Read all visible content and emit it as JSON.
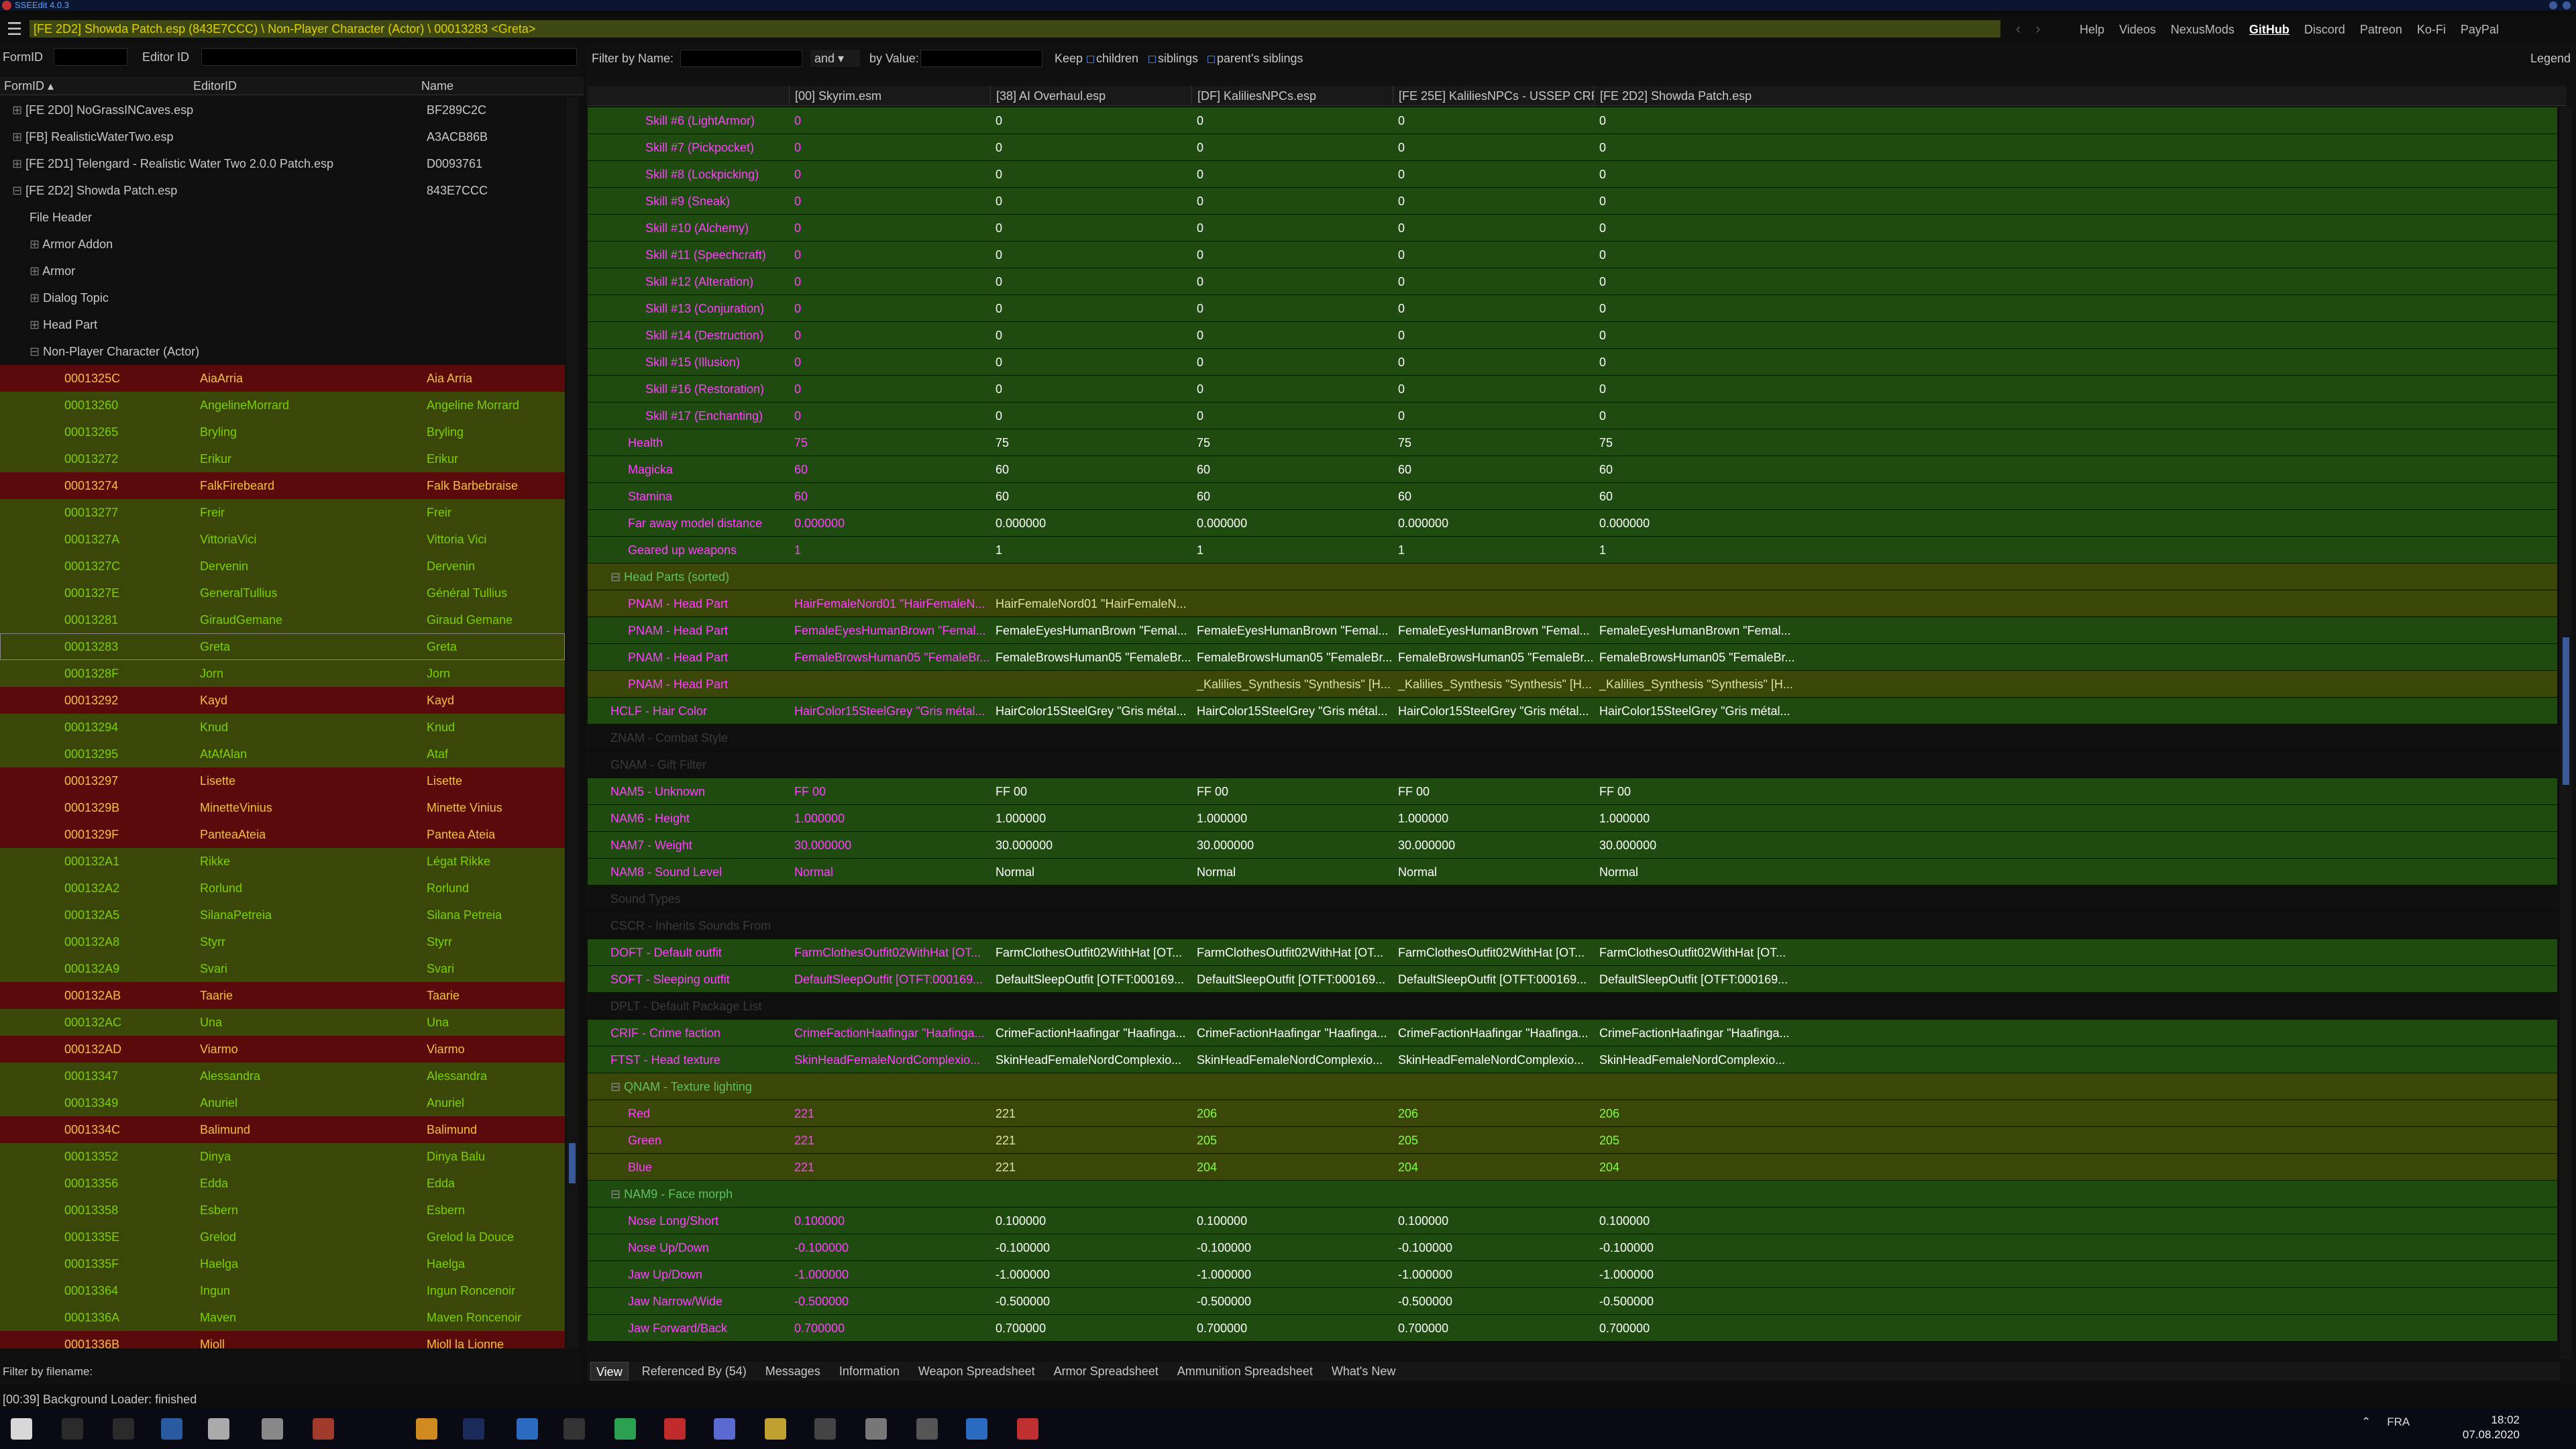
{
  "window": {
    "title": "SSEEdit 4.0.3"
  },
  "header": {
    "path": "[FE 2D2] Showda Patch.esp (843E7CCC) \\ Non-Player Character (Actor) \\ 00013283 <Greta>"
  },
  "toplinks": [
    "Help",
    "Videos",
    "NexusMods",
    "GitHub",
    "Discord",
    "Patreon",
    "Ko-Fi",
    "PayPal"
  ],
  "left": {
    "formid_label": "FormID",
    "editorid_label": "Editor ID",
    "columns": [
      "FormID",
      "EditorID",
      "Name"
    ],
    "plugins": [
      {
        "label": "[FE 2D0] NoGrassINCaves.esp",
        "id": "BF289C2C"
      },
      {
        "label": "[FB] RealisticWaterTwo.esp",
        "id": "A3ACB86B"
      },
      {
        "label": "[FE 2D1] Telengard - Realistic Water Two 2.0.0 Patch.esp",
        "id": "D0093761"
      },
      {
        "label": "[FE 2D2] Showda Patch.esp",
        "id": "843E7CCC"
      }
    ],
    "groups": [
      "File Header",
      "Armor Addon",
      "Armor",
      "Dialog Topic",
      "Head Part",
      "Non-Player Character (Actor)"
    ],
    "npcs": [
      {
        "f": "0001325C",
        "e": "AiaArria",
        "n": "Aia Arria",
        "c": "red"
      },
      {
        "f": "00013260",
        "e": "AngelineMorrard",
        "n": "Angeline Morrard",
        "c": "grn"
      },
      {
        "f": "00013265",
        "e": "Bryling",
        "n": "Bryling",
        "c": "grn"
      },
      {
        "f": "00013272",
        "e": "Erikur",
        "n": "Erikur",
        "c": "grn"
      },
      {
        "f": "00013274",
        "e": "FalkFirebeard",
        "n": "Falk Barbebraise",
        "c": "red"
      },
      {
        "f": "00013277",
        "e": "Freir",
        "n": "Freir",
        "c": "grn"
      },
      {
        "f": "0001327A",
        "e": "VittoriaVici",
        "n": "Vittoria Vici",
        "c": "grn"
      },
      {
        "f": "0001327C",
        "e": "Dervenin",
        "n": "Dervenin",
        "c": "grn"
      },
      {
        "f": "0001327E",
        "e": "GeneralTullius",
        "n": "Général Tullius",
        "c": "grn"
      },
      {
        "f": "00013281",
        "e": "GiraudGemane",
        "n": "Giraud Gemane",
        "c": "grn"
      },
      {
        "f": "00013283",
        "e": "Greta",
        "n": "Greta",
        "c": "sel"
      },
      {
        "f": "0001328F",
        "e": "Jorn",
        "n": "Jorn",
        "c": "grn"
      },
      {
        "f": "00013292",
        "e": "Kayd",
        "n": "Kayd",
        "c": "red"
      },
      {
        "f": "00013294",
        "e": "Knud",
        "n": "Knud",
        "c": "grn"
      },
      {
        "f": "00013295",
        "e": "AtAfAlan",
        "n": "Ataf",
        "c": "grn"
      },
      {
        "f": "00013297",
        "e": "Lisette",
        "n": "Lisette",
        "c": "red"
      },
      {
        "f": "0001329B",
        "e": "MinetteVinius",
        "n": "Minette Vinius",
        "c": "red"
      },
      {
        "f": "0001329F",
        "e": "PanteaAteia",
        "n": "Pantea Ateia",
        "c": "red"
      },
      {
        "f": "000132A1",
        "e": "Rikke",
        "n": "Légat Rikke",
        "c": "grn"
      },
      {
        "f": "000132A2",
        "e": "Rorlund",
        "n": "Rorlund",
        "c": "grn"
      },
      {
        "f": "000132A5",
        "e": "SilanaPetreia",
        "n": "Silana Petreia",
        "c": "grn"
      },
      {
        "f": "000132A8",
        "e": "Styrr",
        "n": "Styrr",
        "c": "grn"
      },
      {
        "f": "000132A9",
        "e": "Svari",
        "n": "Svari",
        "c": "grn"
      },
      {
        "f": "000132AB",
        "e": "Taarie",
        "n": "Taarie",
        "c": "red"
      },
      {
        "f": "000132AC",
        "e": "Una",
        "n": "Una",
        "c": "grn"
      },
      {
        "f": "000132AD",
        "e": "Viarmo",
        "n": "Viarmo",
        "c": "red"
      },
      {
        "f": "00013347",
        "e": "Alessandra",
        "n": "Alessandra",
        "c": "grn"
      },
      {
        "f": "00013349",
        "e": "Anuriel",
        "n": "Anuriel",
        "c": "grn"
      },
      {
        "f": "0001334C",
        "e": "Balimund",
        "n": "Balimund",
        "c": "red"
      },
      {
        "f": "00013352",
        "e": "Dinya",
        "n": "Dinya Balu",
        "c": "grn"
      },
      {
        "f": "00013356",
        "e": "Edda",
        "n": "Edda",
        "c": "grn"
      },
      {
        "f": "00013358",
        "e": "Esbern",
        "n": "Esbern",
        "c": "grn"
      },
      {
        "f": "0001335E",
        "e": "Grelod",
        "n": "Grelod la Douce",
        "c": "grn"
      },
      {
        "f": "0001335F",
        "e": "Haelga",
        "n": "Haelga",
        "c": "grn"
      },
      {
        "f": "00013364",
        "e": "Ingun",
        "n": "Ingun Roncenoir",
        "c": "grn"
      },
      {
        "f": "0001336A",
        "e": "Maven",
        "n": "Maven Roncenoir",
        "c": "grn"
      },
      {
        "f": "0001336B",
        "e": "Mjoll",
        "n": "Mjoll la Lionne",
        "c": "red"
      }
    ],
    "filter_label": "Filter by filename:"
  },
  "right": {
    "filter_name_label": "Filter by Name:",
    "and_label": "and",
    "filter_value_label": "by Value:",
    "keep_label": "Keep",
    "keep_options": [
      "children",
      "siblings",
      "parent's siblings"
    ],
    "legend_label": "Legend",
    "columns": [
      "[00] Skyrim.esm",
      "[38] AI Overhaul.esp",
      "[DF] KaliliesNPCs.esp",
      "[FE 25E] KaliliesNPCs - USSEP CRF ...",
      "[FE 2D2] Showda Patch.esp"
    ],
    "rows": [
      {
        "l": "Skill #6 (LightArmor)",
        "v": [
          "0",
          "0",
          "0",
          "0",
          "0"
        ],
        "c": "g",
        "i": 3
      },
      {
        "l": "Skill #7 (Pickpocket)",
        "v": [
          "0",
          "0",
          "0",
          "0",
          "0"
        ],
        "c": "g",
        "i": 3
      },
      {
        "l": "Skill #8 (Lockpicking)",
        "v": [
          "0",
          "0",
          "0",
          "0",
          "0"
        ],
        "c": "g",
        "i": 3
      },
      {
        "l": "Skill #9 (Sneak)",
        "v": [
          "0",
          "0",
          "0",
          "0",
          "0"
        ],
        "c": "g",
        "i": 3
      },
      {
        "l": "Skill #10 (Alchemy)",
        "v": [
          "0",
          "0",
          "0",
          "0",
          "0"
        ],
        "c": "g",
        "i": 3
      },
      {
        "l": "Skill #11 (Speechcraft)",
        "v": [
          "0",
          "0",
          "0",
          "0",
          "0"
        ],
        "c": "g",
        "i": 3
      },
      {
        "l": "Skill #12 (Alteration)",
        "v": [
          "0",
          "0",
          "0",
          "0",
          "0"
        ],
        "c": "g",
        "i": 3
      },
      {
        "l": "Skill #13 (Conjuration)",
        "v": [
          "0",
          "0",
          "0",
          "0",
          "0"
        ],
        "c": "g",
        "i": 3
      },
      {
        "l": "Skill #14 (Destruction)",
        "v": [
          "0",
          "0",
          "0",
          "0",
          "0"
        ],
        "c": "g",
        "i": 3
      },
      {
        "l": "Skill #15 (Illusion)",
        "v": [
          "0",
          "0",
          "0",
          "0",
          "0"
        ],
        "c": "g",
        "i": 3
      },
      {
        "l": "Skill #16 (Restoration)",
        "v": [
          "0",
          "0",
          "0",
          "0",
          "0"
        ],
        "c": "g",
        "i": 3
      },
      {
        "l": "Skill #17 (Enchanting)",
        "v": [
          "0",
          "0",
          "0",
          "0",
          "0"
        ],
        "c": "g",
        "i": 3
      },
      {
        "l": "Health",
        "v": [
          "75",
          "75",
          "75",
          "75",
          "75"
        ],
        "c": "g",
        "i": 2
      },
      {
        "l": "Magicka",
        "v": [
          "60",
          "60",
          "60",
          "60",
          "60"
        ],
        "c": "g",
        "i": 2
      },
      {
        "l": "Stamina",
        "v": [
          "60",
          "60",
          "60",
          "60",
          "60"
        ],
        "c": "g",
        "i": 2
      },
      {
        "l": "Far away model distance",
        "v": [
          "0.000000",
          "0.000000",
          "0.000000",
          "0.000000",
          "0.000000"
        ],
        "c": "g",
        "i": 2
      },
      {
        "l": "Geared up weapons",
        "v": [
          "1",
          "1",
          "1",
          "1",
          "1"
        ],
        "c": "g",
        "i": 2
      },
      {
        "l": "Head Parts (sorted)",
        "v": [
          "",
          "",
          "",
          "",
          ""
        ],
        "c": "y",
        "i": 1,
        "exp": true
      },
      {
        "l": "PNAM - Head Part",
        "v": [
          "HairFemaleNord01 \"HairFemaleN...",
          "HairFemaleNord01 \"HairFemaleN...",
          "",
          "",
          ""
        ],
        "c": "y",
        "i": 2
      },
      {
        "l": "PNAM - Head Part",
        "v": [
          "FemaleEyesHumanBrown \"Femal...",
          "FemaleEyesHumanBrown \"Femal...",
          "FemaleEyesHumanBrown \"Femal...",
          "FemaleEyesHumanBrown \"Femal...",
          "FemaleEyesHumanBrown \"Femal..."
        ],
        "c": "g",
        "i": 2
      },
      {
        "l": "PNAM - Head Part",
        "v": [
          "FemaleBrowsHuman05 \"FemaleBr...",
          "FemaleBrowsHuman05 \"FemaleBr...",
          "FemaleBrowsHuman05 \"FemaleBr...",
          "FemaleBrowsHuman05 \"FemaleBr...",
          "FemaleBrowsHuman05 \"FemaleBr..."
        ],
        "c": "g",
        "i": 2
      },
      {
        "l": "PNAM - Head Part",
        "v": [
          "",
          "",
          "_Kalilies_Synthesis \"Synthesis\" [H...",
          "_Kalilies_Synthesis \"Synthesis\" [H...",
          "_Kalilies_Synthesis \"Synthesis\" [H..."
        ],
        "c": "y",
        "i": 2
      },
      {
        "l": "HCLF - Hair Color",
        "v": [
          "HairColor15SteelGrey \"Gris métal...",
          "HairColor15SteelGrey \"Gris métal...",
          "HairColor15SteelGrey \"Gris métal...",
          "HairColor15SteelGrey \"Gris métal...",
          "HairColor15SteelGrey \"Gris métal..."
        ],
        "c": "g",
        "i": 1
      },
      {
        "l": "ZNAM - Combat Style",
        "v": [
          "",
          "",
          "",
          "",
          ""
        ],
        "c": "x",
        "i": 1
      },
      {
        "l": "GNAM - Gift Filter",
        "v": [
          "",
          "",
          "",
          "",
          ""
        ],
        "c": "x",
        "i": 1
      },
      {
        "l": "NAM5 - Unknown",
        "v": [
          "FF 00",
          "FF 00",
          "FF 00",
          "FF 00",
          "FF 00"
        ],
        "c": "g",
        "i": 1
      },
      {
        "l": "NAM6 - Height",
        "v": [
          "1.000000",
          "1.000000",
          "1.000000",
          "1.000000",
          "1.000000"
        ],
        "c": "g",
        "i": 1
      },
      {
        "l": "NAM7 - Weight",
        "v": [
          "30.000000",
          "30.000000",
          "30.000000",
          "30.000000",
          "30.000000"
        ],
        "c": "g",
        "i": 1
      },
      {
        "l": "NAM8 - Sound Level",
        "v": [
          "Normal",
          "Normal",
          "Normal",
          "Normal",
          "Normal"
        ],
        "c": "g",
        "i": 1
      },
      {
        "l": "Sound Types",
        "v": [
          "",
          "",
          "",
          "",
          ""
        ],
        "c": "x",
        "i": 1
      },
      {
        "l": "CSCR - Inherits Sounds From",
        "v": [
          "",
          "",
          "",
          "",
          ""
        ],
        "c": "x",
        "i": 1
      },
      {
        "l": "DOFT - Default outfit",
        "v": [
          "FarmClothesOutfit02WithHat [OT...",
          "FarmClothesOutfit02WithHat [OT...",
          "FarmClothesOutfit02WithHat [OT...",
          "FarmClothesOutfit02WithHat [OT...",
          "FarmClothesOutfit02WithHat [OT..."
        ],
        "c": "g",
        "i": 1
      },
      {
        "l": "SOFT - Sleeping outfit",
        "v": [
          "DefaultSleepOutfit [OTFT:000169...",
          "DefaultSleepOutfit [OTFT:000169...",
          "DefaultSleepOutfit [OTFT:000169...",
          "DefaultSleepOutfit [OTFT:000169...",
          "DefaultSleepOutfit [OTFT:000169..."
        ],
        "c": "g",
        "i": 1
      },
      {
        "l": "DPLT - Default Package List",
        "v": [
          "",
          "",
          "",
          "",
          ""
        ],
        "c": "x",
        "i": 1
      },
      {
        "l": "CRIF - Crime faction",
        "v": [
          "CrimeFactionHaafingar \"Haafinga...",
          "CrimeFactionHaafingar \"Haafinga...",
          "CrimeFactionHaafingar \"Haafinga...",
          "CrimeFactionHaafingar \"Haafinga...",
          "CrimeFactionHaafingar \"Haafinga..."
        ],
        "c": "g",
        "i": 1
      },
      {
        "l": "FTST - Head texture",
        "v": [
          "SkinHeadFemaleNordComplexio...",
          "SkinHeadFemaleNordComplexio...",
          "SkinHeadFemaleNordComplexio...",
          "SkinHeadFemaleNordComplexio...",
          "SkinHeadFemaleNordComplexio..."
        ],
        "c": "g",
        "i": 1
      },
      {
        "l": "QNAM - Texture lighting",
        "v": [
          "",
          "",
          "",
          "",
          ""
        ],
        "c": "y",
        "i": 1,
        "exp": true
      },
      {
        "l": "Red",
        "v": [
          "221",
          "221",
          "206",
          "206",
          "206"
        ],
        "c": "y",
        "i": 2,
        "h": [
          2,
          3,
          4
        ]
      },
      {
        "l": "Green",
        "v": [
          "221",
          "221",
          "205",
          "205",
          "205"
        ],
        "c": "y",
        "i": 2,
        "h": [
          2,
          3,
          4
        ]
      },
      {
        "l": "Blue",
        "v": [
          "221",
          "221",
          "204",
          "204",
          "204"
        ],
        "c": "y",
        "i": 2,
        "h": [
          2,
          3,
          4
        ]
      },
      {
        "l": "NAM9 - Face morph",
        "v": [
          "",
          "",
          "",
          "",
          ""
        ],
        "c": "g",
        "i": 1,
        "exp": true
      },
      {
        "l": "Nose Long/Short",
        "v": [
          "0.100000",
          "0.100000",
          "0.100000",
          "0.100000",
          "0.100000"
        ],
        "c": "g",
        "i": 2
      },
      {
        "l": "Nose Up/Down",
        "v": [
          "-0.100000",
          "-0.100000",
          "-0.100000",
          "-0.100000",
          "-0.100000"
        ],
        "c": "g",
        "i": 2
      },
      {
        "l": "Jaw Up/Down",
        "v": [
          "-1.000000",
          "-1.000000",
          "-1.000000",
          "-1.000000",
          "-1.000000"
        ],
        "c": "g",
        "i": 2
      },
      {
        "l": "Jaw Narrow/Wide",
        "v": [
          "-0.500000",
          "-0.500000",
          "-0.500000",
          "-0.500000",
          "-0.500000"
        ],
        "c": "g",
        "i": 2
      },
      {
        "l": "Jaw Forward/Back",
        "v": [
          "0.700000",
          "0.700000",
          "0.700000",
          "0.700000",
          "0.700000"
        ],
        "c": "g",
        "i": 2
      }
    ],
    "tabs": [
      "View",
      "Referenced By (54)",
      "Messages",
      "Information",
      "Weapon Spreadsheet",
      "Armor Spreadsheet",
      "Ammunition Spreadsheet",
      "What's New"
    ]
  },
  "status": "[00:39] Background Loader: finished",
  "taskbar": {
    "lang": "FRA",
    "time": "18:02",
    "date": "07.08.2020"
  },
  "colors": {
    "red_row": "#5a0a0a",
    "green_row": "#3a4708",
    "grid_green": "#1f4a10",
    "accent": "#3a5a9a"
  }
}
